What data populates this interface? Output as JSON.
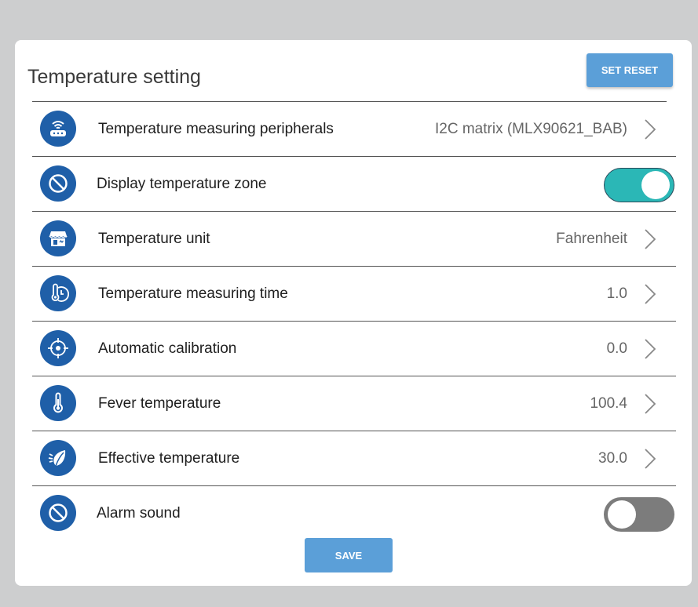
{
  "page": {
    "title": "Temperature setting"
  },
  "buttons": {
    "reset": "SET RESET",
    "save": "SAVE"
  },
  "colors": {
    "accent": "#5b9fd8",
    "icon_bg": "#1f5fa8",
    "toggle_on": "#2bb7b6",
    "toggle_off": "#7c7c7c"
  },
  "settings": [
    {
      "icon": "router-icon",
      "label": "Temperature measuring peripherals",
      "value": "I2C matrix (MLX90621_BAB)"
    },
    {
      "icon": "prohibited-icon",
      "label": "Display temperature zone",
      "toggle": true
    },
    {
      "icon": "storefront-icon",
      "label": "Temperature unit",
      "value": "Fahrenheit"
    },
    {
      "icon": "thermometer-clock-icon",
      "label": "Temperature measuring time",
      "value": "1.0"
    },
    {
      "icon": "target-icon",
      "label": "Automatic calibration",
      "value": "0.0"
    },
    {
      "icon": "thermometer-icon",
      "label": "Fever temperature",
      "value": "100.4"
    },
    {
      "icon": "leaf-icon",
      "label": "Effective temperature",
      "value": "30.0"
    },
    {
      "icon": "prohibited-icon",
      "label": "Alarm sound",
      "toggle": false
    }
  ]
}
